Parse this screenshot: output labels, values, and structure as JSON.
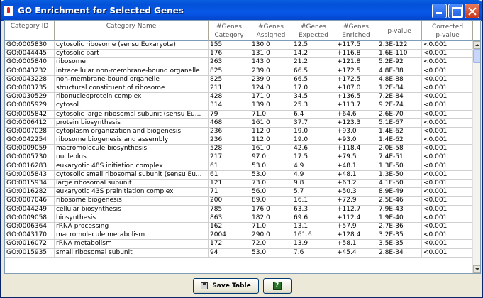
{
  "window": {
    "title": "GO Enrichment for Selected Genes"
  },
  "table": {
    "headers": [
      [
        "Category ID"
      ],
      [
        "Category Name"
      ],
      [
        "#Genes",
        "Category"
      ],
      [
        "#Genes",
        "Assigned"
      ],
      [
        "#Genes",
        "Expected"
      ],
      [
        "#Genes",
        "Enriched"
      ],
      [
        "p-value"
      ],
      [
        "Corrected",
        "p-value"
      ]
    ],
    "rows": [
      [
        "GO:0005830",
        "cytosolic ribosome (sensu Eukaryota)",
        "155",
        "130.0",
        "12.5",
        "+117.5",
        "2.3E-122",
        "<0.001"
      ],
      [
        "GO:0044445",
        "cytosolic part",
        "176",
        "131.0",
        "14.2",
        "+116.8",
        "1.6E-110",
        "<0.001"
      ],
      [
        "GO:0005840",
        "ribosome",
        "263",
        "143.0",
        "21.2",
        "+121.8",
        "5.2E-92",
        "<0.001"
      ],
      [
        "GO:0043232",
        "intracellular non-membrane-bound organelle",
        "825",
        "239.0",
        "66.5",
        "+172.5",
        "4.8E-88",
        "<0.001"
      ],
      [
        "GO:0043228",
        "non-membrane-bound organelle",
        "825",
        "239.0",
        "66.5",
        "+172.5",
        "4.8E-88",
        "<0.001"
      ],
      [
        "GO:0003735",
        "structural constituent of ribosome",
        "211",
        "124.0",
        "17.0",
        "+107.0",
        "1.2E-84",
        "<0.001"
      ],
      [
        "GO:0030529",
        "ribonucleoprotein complex",
        "428",
        "171.0",
        "34.5",
        "+136.5",
        "7.2E-84",
        "<0.001"
      ],
      [
        "GO:0005929",
        "cytosol",
        "314",
        "139.0",
        "25.3",
        "+113.7",
        "9.2E-74",
        "<0.001"
      ],
      [
        "GO:0005842",
        "cytosolic large ribosomal subunit (sensu Eu...",
        "79",
        "71.0",
        "6.4",
        "+64.6",
        "2.6E-70",
        "<0.001"
      ],
      [
        "GO:0006412",
        "protein biosynthesis",
        "468",
        "161.0",
        "37.7",
        "+123.3",
        "5.1E-67",
        "<0.001"
      ],
      [
        "GO:0007028",
        "cytoplasm organization and biogenesis",
        "236",
        "112.0",
        "19.0",
        "+93.0",
        "1.4E-62",
        "<0.001"
      ],
      [
        "GO:0042254",
        "ribosome biogenesis and assembly",
        "236",
        "112.0",
        "19.0",
        "+93.0",
        "1.4E-62",
        "<0.001"
      ],
      [
        "GO:0009059",
        "macromolecule biosynthesis",
        "528",
        "161.0",
        "42.6",
        "+118.4",
        "2.0E-58",
        "<0.001"
      ],
      [
        "GO:0005730",
        "nucleolus",
        "217",
        "97.0",
        "17.5",
        "+79.5",
        "7.4E-51",
        "<0.001"
      ],
      [
        "GO:0016283",
        "eukaryotic 48S initiation complex",
        "61",
        "53.0",
        "4.9",
        "+48.1",
        "1.3E-50",
        "<0.001"
      ],
      [
        "GO:0005843",
        "cytosolic small ribosomal subunit (sensu Eu...",
        "61",
        "53.0",
        "4.9",
        "+48.1",
        "1.3E-50",
        "<0.001"
      ],
      [
        "GO:0015934",
        "large ribosomal subunit",
        "121",
        "73.0",
        "9.8",
        "+63.2",
        "4.1E-50",
        "<0.001"
      ],
      [
        "GO:0016282",
        "eukaryotic 43S preinitiation complex",
        "71",
        "56.0",
        "5.7",
        "+50.3",
        "8.9E-49",
        "<0.001"
      ],
      [
        "GO:0007046",
        "ribosome biogenesis",
        "200",
        "89.0",
        "16.1",
        "+72.9",
        "2.5E-46",
        "<0.001"
      ],
      [
        "GO:0044249",
        "cellular biosynthesis",
        "785",
        "176.0",
        "63.3",
        "+112.7",
        "7.9E-43",
        "<0.001"
      ],
      [
        "GO:0009058",
        "biosynthesis",
        "863",
        "182.0",
        "69.6",
        "+112.4",
        "1.9E-40",
        "<0.001"
      ],
      [
        "GO:0006364",
        "rRNA processing",
        "162",
        "71.0",
        "13.1",
        "+57.9",
        "2.7E-36",
        "<0.001"
      ],
      [
        "GO:0043170",
        "macromolecule metabolism",
        "2004",
        "290.0",
        "161.6",
        "+128.4",
        "3.2E-35",
        "<0.001"
      ],
      [
        "GO:0016072",
        "rRNA metabolism",
        "172",
        "72.0",
        "13.9",
        "+58.1",
        "3.5E-35",
        "<0.001"
      ],
      [
        "GO:0015935",
        "small ribosomal subunit",
        "94",
        "53.0",
        "7.6",
        "+45.4",
        "2.8E-34",
        "<0.001"
      ]
    ]
  },
  "buttons": {
    "save_label": "Save Table"
  },
  "icons": {
    "save": "floppy-disk-icon",
    "help": "help-icon"
  },
  "colors": {
    "titlebar": "#0351d8",
    "grid": "#d0d0d0",
    "window_bg": "#ece9d8"
  }
}
